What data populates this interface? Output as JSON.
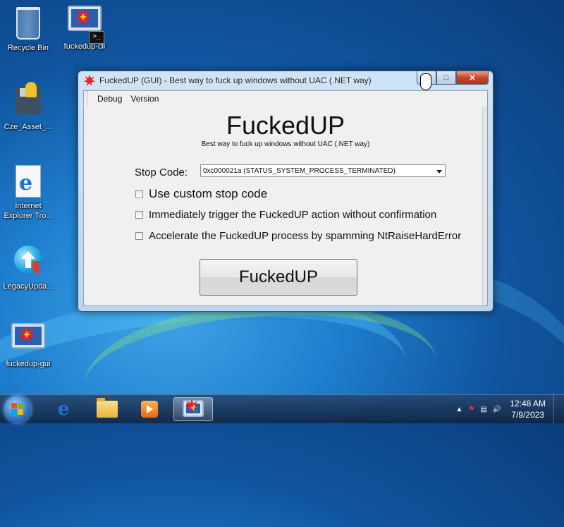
{
  "desktop": {
    "icons": [
      {
        "label": "Recycle Bin"
      },
      {
        "label": "fuckedup-cli"
      },
      {
        "label": "Cze_Asset_..."
      },
      {
        "label": "Internet Explorer Tro..."
      },
      {
        "label": "LegacyUpda..."
      },
      {
        "label": "fuckedup-gui"
      }
    ]
  },
  "window": {
    "title": "FuckedUP (GUI) - Best way to fuck up windows without UAC (.NET way)",
    "menu": [
      "Debug",
      "Version"
    ],
    "app_title": "FuckedUP",
    "app_subtitle": "Best way to fuck up windows without UAC (.NET way)",
    "stop_code_label": "Stop Code:",
    "stop_code_value": "0xc000021a (STATUS_SYSTEM_PROCESS_TERMINATED)",
    "options": [
      {
        "label": "Use custom stop code",
        "checked": false
      },
      {
        "label": "Immediately trigger the FuckedUP action without confirmation",
        "checked": false
      },
      {
        "label": "Accelerate the FuckedUP process by spamming NtRaiseHardError",
        "checked": false
      }
    ],
    "action_button": "FuckedUP"
  },
  "taskbar": {
    "clock_time": "12:48 AM",
    "clock_date": "7/9/2023"
  },
  "colors": {
    "close_button": "#c8452c",
    "burst_red": "#e6222a",
    "burst_yellow": "#ffd21a"
  }
}
